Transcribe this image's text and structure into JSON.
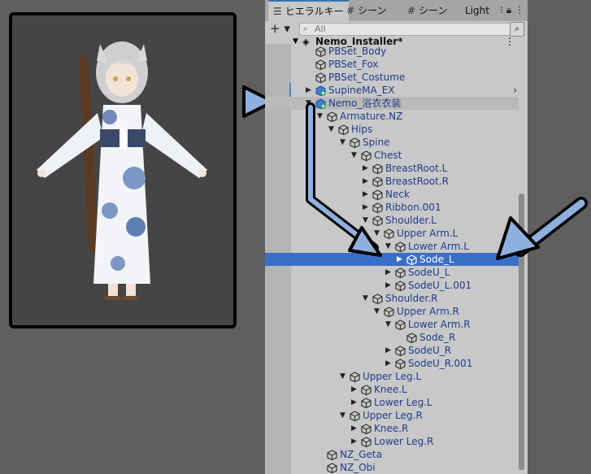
{
  "tabs": [
    {
      "icon": "hierarchy-icon",
      "label": "ヒエラルキー",
      "active": true
    },
    {
      "icon": "grid-icon",
      "label": "シーン",
      "active": false
    },
    {
      "icon": "grid-icon",
      "label": "シーン",
      "active": false
    },
    {
      "icon": "",
      "label": "Light",
      "active": false
    }
  ],
  "toolbar": {
    "add_label": "+ ▾",
    "search_placeholder": "All"
  },
  "scene": {
    "label": "Nemo_Installer*"
  },
  "rows": [
    {
      "label": "PBSet_Body",
      "depth": 0,
      "toggle": "none",
      "icon": "prefab-icon"
    },
    {
      "label": "PBSet_Fox",
      "depth": 0,
      "toggle": "none",
      "icon": "prefab-icon"
    },
    {
      "label": "PBSet_Costume",
      "depth": 0,
      "toggle": "none",
      "icon": "prefab-icon"
    },
    {
      "label": "SupineMA_EX",
      "depth": 0,
      "toggle": "collapsed",
      "icon": "prefab-add-icon",
      "chevron": true
    },
    {
      "label": "Nemo_浴衣衣装",
      "depth": 0,
      "toggle": "expanded",
      "icon": "prefab-add-icon",
      "highlight": true
    },
    {
      "label": "Armature.NZ",
      "depth": 1,
      "toggle": "expanded",
      "icon": "gameobject-icon"
    },
    {
      "label": "Hips",
      "depth": 2,
      "toggle": "expanded",
      "icon": "gameobject-icon"
    },
    {
      "label": "Spine",
      "depth": 3,
      "toggle": "expanded",
      "icon": "gameobject-icon"
    },
    {
      "label": "Chest",
      "depth": 4,
      "toggle": "expanded",
      "icon": "gameobject-icon"
    },
    {
      "label": "BreastRoot.L",
      "depth": 5,
      "toggle": "collapsed",
      "icon": "gameobject-icon"
    },
    {
      "label": "BreastRoot.R",
      "depth": 5,
      "toggle": "collapsed",
      "icon": "gameobject-icon"
    },
    {
      "label": "Neck",
      "depth": 5,
      "toggle": "collapsed",
      "icon": "gameobject-icon"
    },
    {
      "label": "Ribbon.001",
      "depth": 5,
      "toggle": "collapsed",
      "icon": "gameobject-icon"
    },
    {
      "label": "Shoulder.L",
      "depth": 5,
      "toggle": "expanded",
      "icon": "gameobject-icon"
    },
    {
      "label": "Upper Arm.L",
      "depth": 6,
      "toggle": "expanded",
      "icon": "gameobject-icon"
    },
    {
      "label": "Lower Arm.L",
      "depth": 7,
      "toggle": "expanded",
      "icon": "gameobject-icon"
    },
    {
      "label": "Sode_L",
      "depth": 8,
      "toggle": "collapsed",
      "icon": "gameobject-icon",
      "selected": true
    },
    {
      "label": "SodeU_L",
      "depth": 7,
      "toggle": "collapsed",
      "icon": "gameobject-icon"
    },
    {
      "label": "SodeU_L.001",
      "depth": 7,
      "toggle": "collapsed",
      "icon": "gameobject-icon"
    },
    {
      "label": "Shoulder.R",
      "depth": 5,
      "toggle": "expanded",
      "icon": "gameobject-icon"
    },
    {
      "label": "Upper Arm.R",
      "depth": 6,
      "toggle": "expanded",
      "icon": "gameobject-icon"
    },
    {
      "label": "Lower Arm.R",
      "depth": 7,
      "toggle": "expanded",
      "icon": "gameobject-icon"
    },
    {
      "label": "Sode_R",
      "depth": 8,
      "toggle": "none",
      "icon": "gameobject-icon"
    },
    {
      "label": "SodeU_R",
      "depth": 7,
      "toggle": "collapsed",
      "icon": "gameobject-icon"
    },
    {
      "label": "SodeU_R.001",
      "depth": 7,
      "toggle": "collapsed",
      "icon": "gameobject-icon"
    },
    {
      "label": "Upper Leg.L",
      "depth": 3,
      "toggle": "expanded",
      "icon": "gameobject-icon"
    },
    {
      "label": "Knee.L",
      "depth": 4,
      "toggle": "collapsed",
      "icon": "gameobject-icon"
    },
    {
      "label": "Lower Leg.L",
      "depth": 4,
      "toggle": "collapsed",
      "icon": "gameobject-icon"
    },
    {
      "label": "Upper Leg.R",
      "depth": 3,
      "toggle": "expanded",
      "icon": "gameobject-icon"
    },
    {
      "label": "Knee.R",
      "depth": 4,
      "toggle": "collapsed",
      "icon": "gameobject-icon"
    },
    {
      "label": "Lower Leg.R",
      "depth": 4,
      "toggle": "collapsed",
      "icon": "gameobject-icon"
    },
    {
      "label": "NZ_Geta",
      "depth": 1,
      "toggle": "none",
      "icon": "gameobject-icon"
    },
    {
      "label": "NZ_Obi",
      "depth": 1,
      "toggle": "none",
      "icon": "gameobject-icon"
    }
  ],
  "colors": {
    "selection": "#3b6ec5",
    "label_text": "#1e3c8a",
    "annotation_arrow": "#8db0e0"
  }
}
